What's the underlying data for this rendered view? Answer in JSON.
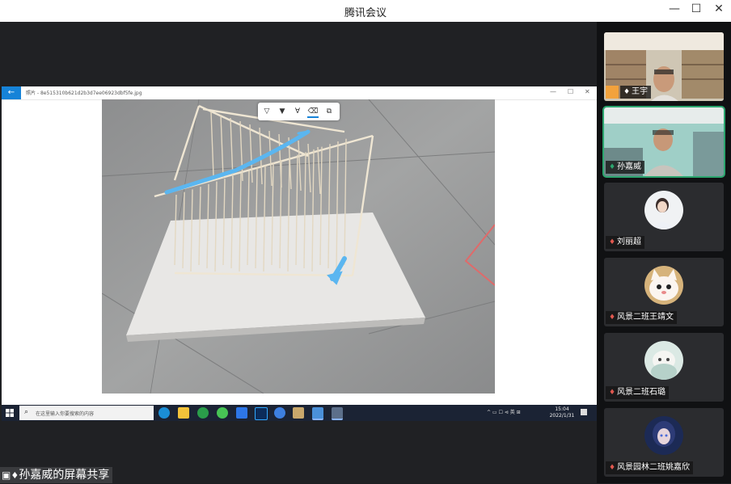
{
  "window": {
    "title": "腾讯会议",
    "minimize": "—",
    "maximize": "☐",
    "close": "✕"
  },
  "shared_screen": {
    "viewer": {
      "back": "←",
      "file_title": "照片 - 8e515310b621d2b3d7ee06923dbf5fe.jpg",
      "minimize": "—",
      "maximize": "☐",
      "close": "✕"
    },
    "annotation_tools": [
      "pen-icon",
      "highlighter-icon",
      "pencil-icon",
      "eraser-icon",
      "copy-icon"
    ],
    "taskbar": {
      "search_placeholder": "在这里输入你要搜索的内容",
      "apps": [
        "edge-icon",
        "file-explorer-icon",
        "media-icon",
        "wechat-icon",
        "tencent-meeting-icon",
        "photoshop-icon",
        "browser-icon",
        "app-icon",
        "photos-icon",
        "image-viewer-icon"
      ],
      "tray_text": "^ ▭ ☐ ⊲ 英 ⊞",
      "time": "15:04",
      "date": "2022/1/31"
    }
  },
  "screen_share_label": "孙嘉威的屏幕共享",
  "participants": [
    {
      "name": "王宇",
      "mic": "on",
      "host": true
    },
    {
      "name": "孙嘉威",
      "mic": "on",
      "speaking": true
    },
    {
      "name": "刘丽超",
      "mic": "muted"
    },
    {
      "name": "风景二班王靖文",
      "mic": "muted"
    },
    {
      "name": "风景二班石璐",
      "mic": "muted"
    },
    {
      "name": "风景园林二班姚嘉欣",
      "mic": "muted"
    }
  ],
  "colors": {
    "accent_green": "#2ca66f",
    "annotation_blue": "#5bb6f0",
    "taskbar": "#1b2334"
  }
}
